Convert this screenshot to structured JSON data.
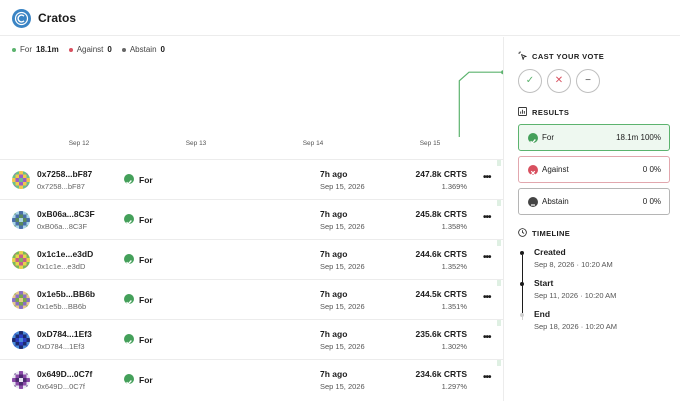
{
  "app": {
    "name": "Cratos",
    "logo_icon": "cratos-logo"
  },
  "legend": [
    {
      "label": "For",
      "value": "18.1m",
      "color": "#5cb36e"
    },
    {
      "label": "Against",
      "value": "0",
      "color": "#d8505f"
    },
    {
      "label": "Abstain",
      "value": "0",
      "color": "#666666"
    }
  ],
  "chart_data": {
    "type": "line",
    "x_ticks": [
      "Sep 12",
      "Sep 13",
      "Sep 14",
      "Sep 15"
    ],
    "series": [
      {
        "name": "For",
        "color": "#5cb36e",
        "points": [
          [
            "Sep 15 06:00",
            0
          ],
          [
            "Sep 15 06:00",
            0.65
          ],
          [
            "Sep 15 08:00",
            0.75
          ],
          [
            "Sep 15 15:00",
            0.75
          ]
        ]
      }
    ]
  },
  "votes": [
    {
      "address": "0x7258...bF87",
      "address_short": "0x7258...bF87",
      "vote": "For",
      "time": "7h ago",
      "date": "Sep 15, 2026",
      "amount": "247.8k CRTS",
      "percent": "1.369%",
      "avatar_colors": [
        "#9a5ec4",
        "#6bbf8a",
        "#f2c94c"
      ]
    },
    {
      "address": "0xB06a...8C3F",
      "address_short": "0xB06a...8C3F",
      "vote": "For",
      "time": "7h ago",
      "date": "Sep 15, 2026",
      "amount": "245.8k CRTS",
      "percent": "1.358%",
      "avatar_colors": [
        "#5a8a5c",
        "#a8d4e6",
        "#4a6ea8"
      ]
    },
    {
      "address": "0x1c1e...e3dD",
      "address_short": "0x1c1e...e3dD",
      "vote": "For",
      "time": "7h ago",
      "date": "Sep 15, 2026",
      "amount": "244.6k CRTS",
      "percent": "1.352%",
      "avatar_colors": [
        "#c45e8a",
        "#7ab85a",
        "#e8d34c"
      ]
    },
    {
      "address": "0x1e5b...BB6b",
      "address_short": "0x1e5b...BB6b",
      "vote": "For",
      "time": "7h ago",
      "date": "Sep 15, 2026",
      "amount": "244.5k CRTS",
      "percent": "1.351%",
      "avatar_colors": [
        "#7aa84a",
        "#e6c88a",
        "#8a6ec4"
      ]
    },
    {
      "address": "0xD784...1Ef3",
      "address_short": "0xD784...1Ef3",
      "vote": "For",
      "time": "7h ago",
      "date": "Sep 15, 2026",
      "amount": "235.6k CRTS",
      "percent": "1.302%",
      "avatar_colors": [
        "#2a3ec4",
        "#4a8ad8",
        "#1c2a6e"
      ]
    },
    {
      "address": "0x649D...0C7f",
      "address_short": "0x649D...0C7f",
      "vote": "For",
      "time": "7h ago",
      "date": "Sep 15, 2026",
      "amount": "234.6k CRTS",
      "percent": "1.297%",
      "avatar_colors": [
        "#4a2a6e",
        "#e6e6f0",
        "#8a4aa8"
      ]
    }
  ],
  "sidebar": {
    "cast_title": "CAST YOUR VOTE",
    "results_title": "RESULTS",
    "results": [
      {
        "label": "For",
        "amount": "18.1m",
        "percent": "100%",
        "color": "#5cb36e"
      },
      {
        "label": "Against",
        "amount": "0",
        "percent": "0%",
        "color": "#d8505f"
      },
      {
        "label": "Abstain",
        "amount": "0",
        "percent": "0%",
        "color": "#444444"
      }
    ],
    "timeline_title": "TIMELINE",
    "timeline": [
      {
        "title": "Created",
        "date": "Sep 8, 2026 · 10:20 AM"
      },
      {
        "title": "Start",
        "date": "Sep 11, 2026 · 10:20 AM"
      },
      {
        "title": "End",
        "date": "Sep 18, 2026 · 10:20 AM"
      }
    ]
  }
}
